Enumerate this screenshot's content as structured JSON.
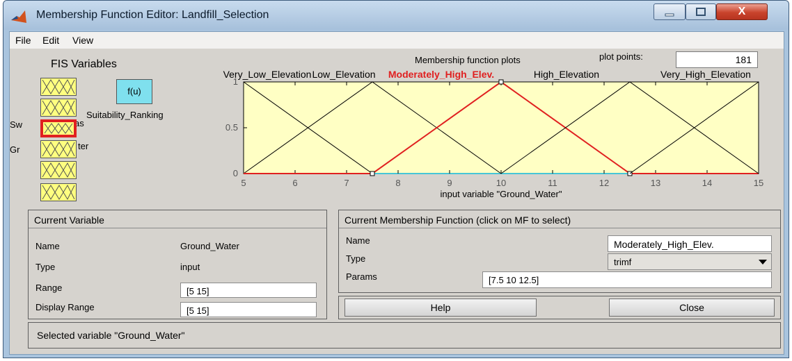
{
  "window": {
    "title": "Membership Function Editor: Landfill_Selection",
    "close_glyph": "X"
  },
  "menu": {
    "items": [
      "File",
      "Edit",
      "View"
    ]
  },
  "fis": {
    "title": "FIS Variables",
    "output_block_label": "f(u)",
    "output_label": "Suitability_Ranking",
    "labels": {
      "sw": "Sw",
      "as": "as",
      "gr": "Gr",
      "ter": "ter"
    }
  },
  "plot": {
    "title": "Membership function plots",
    "plot_points_label": "plot points:",
    "plot_points_value": "181"
  },
  "chart_data": {
    "type": "line",
    "xlabel": "input variable \"Ground_Water\"",
    "xlim": [
      5,
      15
    ],
    "ylim": [
      0,
      1
    ],
    "xticks": [
      "5",
      "6",
      "7",
      "8",
      "9",
      "10",
      "11",
      "12",
      "13",
      "14",
      "15"
    ],
    "yticks": [
      "0",
      "0.5",
      "1"
    ],
    "selected_index": 2,
    "series": [
      {
        "name": "Very_Low_Elevation",
        "label": "Very_Low_Elevation",
        "x": [
          5,
          7.5
        ],
        "y": [
          1,
          0
        ],
        "color": "#000000"
      },
      {
        "name": "Low_Elevation",
        "label": "Low_Elevation",
        "x": [
          5,
          7.5,
          10
        ],
        "y": [
          0,
          1,
          0
        ],
        "color": "#000000"
      },
      {
        "name": "Moderately_High_Elev.",
        "label": "Moderately_High_Elev.",
        "x": [
          7.5,
          10,
          12.5
        ],
        "y": [
          0,
          1,
          0
        ],
        "color": "#e02020"
      },
      {
        "name": "High_Elevation",
        "label": "High_Elevation",
        "x": [
          10,
          12.5,
          15
        ],
        "y": [
          0,
          1,
          0
        ],
        "color": "#000000"
      },
      {
        "name": "Very_High_Elevation",
        "label": "Very_High_Elevation",
        "x": [
          12.5,
          15
        ],
        "y": [
          0,
          1
        ],
        "color": "#000000"
      }
    ]
  },
  "current_variable": {
    "header": "Current Variable",
    "name_label": "Name",
    "name_value": "Ground_Water",
    "type_label": "Type",
    "type_value": "input",
    "range_label": "Range",
    "range_value": "[5 15]",
    "display_range_label": "Display Range",
    "display_range_value": "[5 15]"
  },
  "current_mf": {
    "header": "Current Membership Function (click on MF to select)",
    "name_label": "Name",
    "name_value": "Moderately_High_Elev.",
    "type_label": "Type",
    "type_value": "trimf",
    "params_label": "Params",
    "params_value": "[7.5 10 12.5]"
  },
  "buttons": {
    "help": "Help",
    "close": "Close"
  },
  "status": "Selected variable \"Ground_Water\"",
  "colors": {
    "plot_bg": "#ffffc4",
    "selected_mf": "#e02020",
    "input_block": "#ffff80",
    "output_block": "#7fe0ee"
  }
}
